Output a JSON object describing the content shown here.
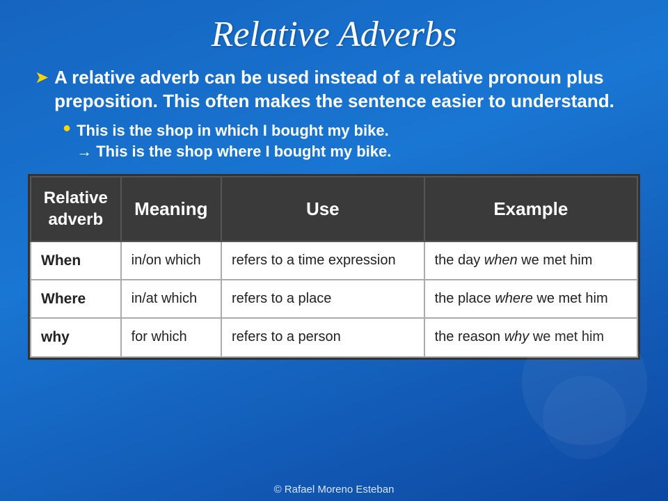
{
  "title": "Relative Adverbs",
  "intro": {
    "bullet": "A relative adverb can be used instead of a relative pronoun plus preposition. This often makes the sentence easier to understand.",
    "sub_bullet_line1": "This is the shop in which I bought my bike.",
    "sub_bullet_line2": "→ This is the shop where I bought my bike."
  },
  "table": {
    "headers": [
      "Relative adverb",
      "Meaning",
      "Use",
      "Example"
    ],
    "rows": [
      {
        "adverb": "When",
        "meaning": "in/on which",
        "use": "refers to a time expression",
        "example_plain": "the day ",
        "example_italic": "when",
        "example_end": " we met him"
      },
      {
        "adverb": "Where",
        "meaning": "in/at which",
        "use": "refers to a place",
        "example_plain": "the place ",
        "example_italic": "where",
        "example_end": " we met him"
      },
      {
        "adverb": "why",
        "meaning": "for which",
        "use": "refers to a person",
        "example_plain": "the reason ",
        "example_italic": "why",
        "example_end": " we met him"
      }
    ]
  },
  "footer": "© Rafael Moreno Esteban"
}
